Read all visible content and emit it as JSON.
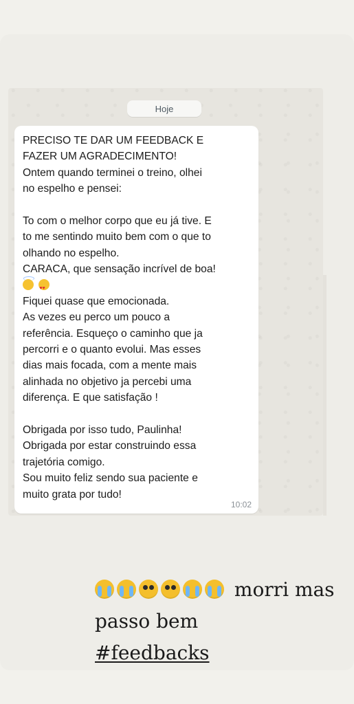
{
  "chat": {
    "date_label": "Hoje",
    "message_lines": [
      "PRECISO TE DAR UM FEEDBACK E",
      "FAZER UM AGRADECIMENTO!",
      "Ontem quando terminei o treino, olhei",
      "no espelho e pensei:",
      "",
      "To com o melhor corpo que eu já tive. E",
      "to me sentindo muito bem com o que to",
      "olhando no espelho.",
      "CARACA, que sensação incrível de boa!",
      "",
      "Fiquei quase que emocionada.",
      "As vezes eu perco um pouco a",
      "referência. Esqueço o caminho que ja",
      "percorri e o quanto evolui. Mas esses",
      "dias mais focada, com a mente mais",
      "alinhada no objetivo ja percebi uma",
      "diferença. E que satisfação !",
      "",
      "Obrigada por isso tudo, Paulinha!",
      "Obrigada por estar construindo essa",
      "trajetória comigo.",
      "Sou muito feliz sendo sua paciente e",
      "muito grata por tudo!"
    ],
    "time": "10:02"
  },
  "caption": {
    "line1": "morri mas",
    "line2": "passo bem",
    "hashtag": "#feedbacks"
  },
  "icons": {
    "message_emojis": [
      "halo-smile-icon",
      "heart-eyes-icon"
    ],
    "caption_emojis": [
      "crying-face-icon",
      "crying-face-icon",
      "pleading-face-icon",
      "pleading-face-icon",
      "crying-face-icon",
      "crying-face-icon"
    ]
  }
}
